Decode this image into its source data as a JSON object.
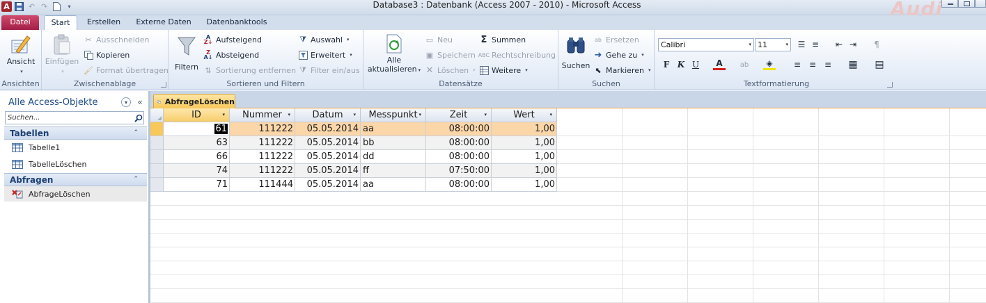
{
  "window": {
    "title": "Database3 : Datenbank (Access 2007 - 2010)  -  Microsoft Access",
    "watermark": "Audi"
  },
  "ribbon_tabs": [
    "Datei",
    "Start",
    "Erstellen",
    "Externe Daten",
    "Datenbanktools"
  ],
  "ribbon": {
    "ansichten": {
      "label": "Ansichten",
      "ansicht": "Ansicht"
    },
    "zwischenablage": {
      "label": "Zwischenablage",
      "einfuegen": "Einfügen",
      "ausschneiden": "Ausschneiden",
      "kopieren": "Kopieren",
      "format": "Format übertragen"
    },
    "sortieren": {
      "label": "Sortieren und Filtern",
      "filtern": "Filtern",
      "aufsteigend": "Aufsteigend",
      "absteigend": "Absteigend",
      "sortierung_entfernen": "Sortierung entfernen",
      "auswahl": "Auswahl",
      "erweitert": "Erweitert",
      "filter_einaus": "Filter ein/aus"
    },
    "datensaetze": {
      "label": "Datensätze",
      "alle": "Alle",
      "aktualisieren": "aktualisieren",
      "neu": "Neu",
      "speichern": "Speichern",
      "loeschen": "Löschen",
      "summen": "Summen",
      "rechtschreibung": "Rechtschreibung",
      "weitere": "Weitere"
    },
    "suchen": {
      "label": "Suchen",
      "suchen": "Suchen",
      "ersetzen": "Ersetzen",
      "gehe_zu": "Gehe zu",
      "markieren": "Markieren"
    },
    "text": {
      "label": "Textformatierung",
      "font": "Calibri",
      "size": "11",
      "bold": "F",
      "italic": "K",
      "underline": "U"
    }
  },
  "nav": {
    "title": "Alle Access-Objekte",
    "search_placeholder": "Suchen...",
    "groups": [
      {
        "label": "Tabellen",
        "items": [
          "Tabelle1",
          "TabelleLöschen"
        ]
      },
      {
        "label": "Abfragen",
        "items": [
          "AbfrageLöschen"
        ]
      }
    ]
  },
  "document": {
    "tab": "AbfrageLöschen",
    "columns": [
      "ID",
      "Nummer",
      "Datum",
      "Messpunkt",
      "Zeit",
      "Wert"
    ],
    "rows": [
      [
        "61",
        "111222",
        "05.05.2014",
        "aa",
        "08:00:00",
        "1,00"
      ],
      [
        "63",
        "111222",
        "05.05.2014",
        "bb",
        "08:00:00",
        "1,00"
      ],
      [
        "66",
        "111222",
        "05.05.2014",
        "dd",
        "08:00:00",
        "1,00"
      ],
      [
        "74",
        "111222",
        "05.05.2014",
        "ff",
        "07:50:00",
        "1,00"
      ],
      [
        "71",
        "111444",
        "05.05.2014",
        "aa",
        "08:00:00",
        "1,00"
      ]
    ]
  },
  "colors": {
    "file_tab": "#b52a52",
    "active_tab": "#f8c95a",
    "current_row": "#fbd6a9"
  }
}
